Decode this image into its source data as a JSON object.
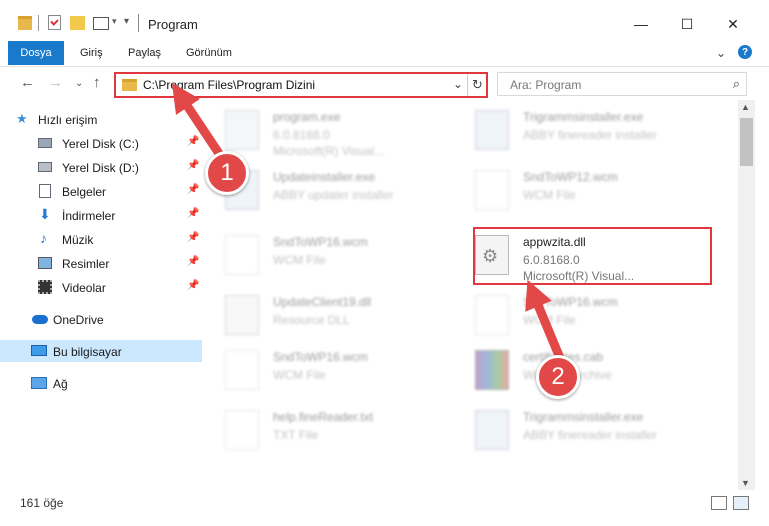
{
  "window": {
    "title": "Program",
    "minimize_glyph": "—",
    "maximize_glyph": "☐",
    "close_glyph": "✕"
  },
  "ribbon": {
    "file_tab": "Dosya",
    "tabs": [
      "Giriş",
      "Paylaş",
      "Görünüm"
    ]
  },
  "nav": {
    "address": "C:\\Program Files\\Program Dizini",
    "search_placeholder": "Ara: Program"
  },
  "sidebar": {
    "items": [
      {
        "label": "Hızlı erişim",
        "icon": "star-icon"
      },
      {
        "label": "Yerel Disk (C:)",
        "icon": "drive-icon",
        "pinned": true
      },
      {
        "label": "Yerel Disk (D:)",
        "icon": "drive-icon",
        "pinned": true
      },
      {
        "label": "Belgeler",
        "icon": "documents-icon",
        "pinned": true
      },
      {
        "label": "İndirmeler",
        "icon": "download-icon",
        "pinned": true
      },
      {
        "label": "Müzik",
        "icon": "music-icon",
        "pinned": true
      },
      {
        "label": "Resimler",
        "icon": "pictures-icon",
        "pinned": true
      },
      {
        "label": "Videolar",
        "icon": "videos-icon",
        "pinned": true
      },
      {
        "label": "OneDrive",
        "icon": "cloud-icon"
      },
      {
        "label": "Bu bilgisayar",
        "icon": "computer-icon",
        "selected": true
      },
      {
        "label": "Ağ",
        "icon": "network-icon"
      }
    ]
  },
  "files": [
    {
      "name": "program.exe",
      "line1": "6.0.8168.0",
      "line2": "Microsoft(R) Visual...",
      "faded": true
    },
    {
      "name": "Trigrammsinstaller.exe",
      "line1": "ABBY finereader installer",
      "faded": true
    },
    {
      "name": "Updateinstaller.exe",
      "line1": "ABBY updater installer",
      "faded": true
    },
    {
      "name": "SndToWP12.wcm",
      "line1": "WCM File",
      "faded": true
    },
    {
      "name": "SndToWP16.wcm",
      "line1": "WCM File",
      "faded": true
    },
    {
      "name": "appwzita.dll",
      "line1": "6.0.8168.0",
      "line2": "Microsoft(R) Visual...",
      "faded": false
    },
    {
      "name": "UpdateClient19.dll",
      "line1": "Resource DLL",
      "faded": true
    },
    {
      "name": "SndToWP16.wcm",
      "line1": "WCM File",
      "faded": true
    },
    {
      "name": "SndToWP16.wcm",
      "line1": "WCM File",
      "faded": true
    },
    {
      "name": "certificates.cab",
      "line1": "WinRAR Archive",
      "faded": true
    },
    {
      "name": "help.fineReader.txt",
      "line1": "TXT File",
      "faded": true
    },
    {
      "name": "Trigrammsinstaller.exe",
      "line1": "ABBY finereader installer",
      "faded": true
    }
  ],
  "status": {
    "item_count": "161 öğe"
  },
  "annotations": {
    "badge1": "1",
    "badge2": "2"
  },
  "colors": {
    "accent": "#1979ca",
    "highlight": "#e0383e",
    "selection": "#cce8ff"
  }
}
